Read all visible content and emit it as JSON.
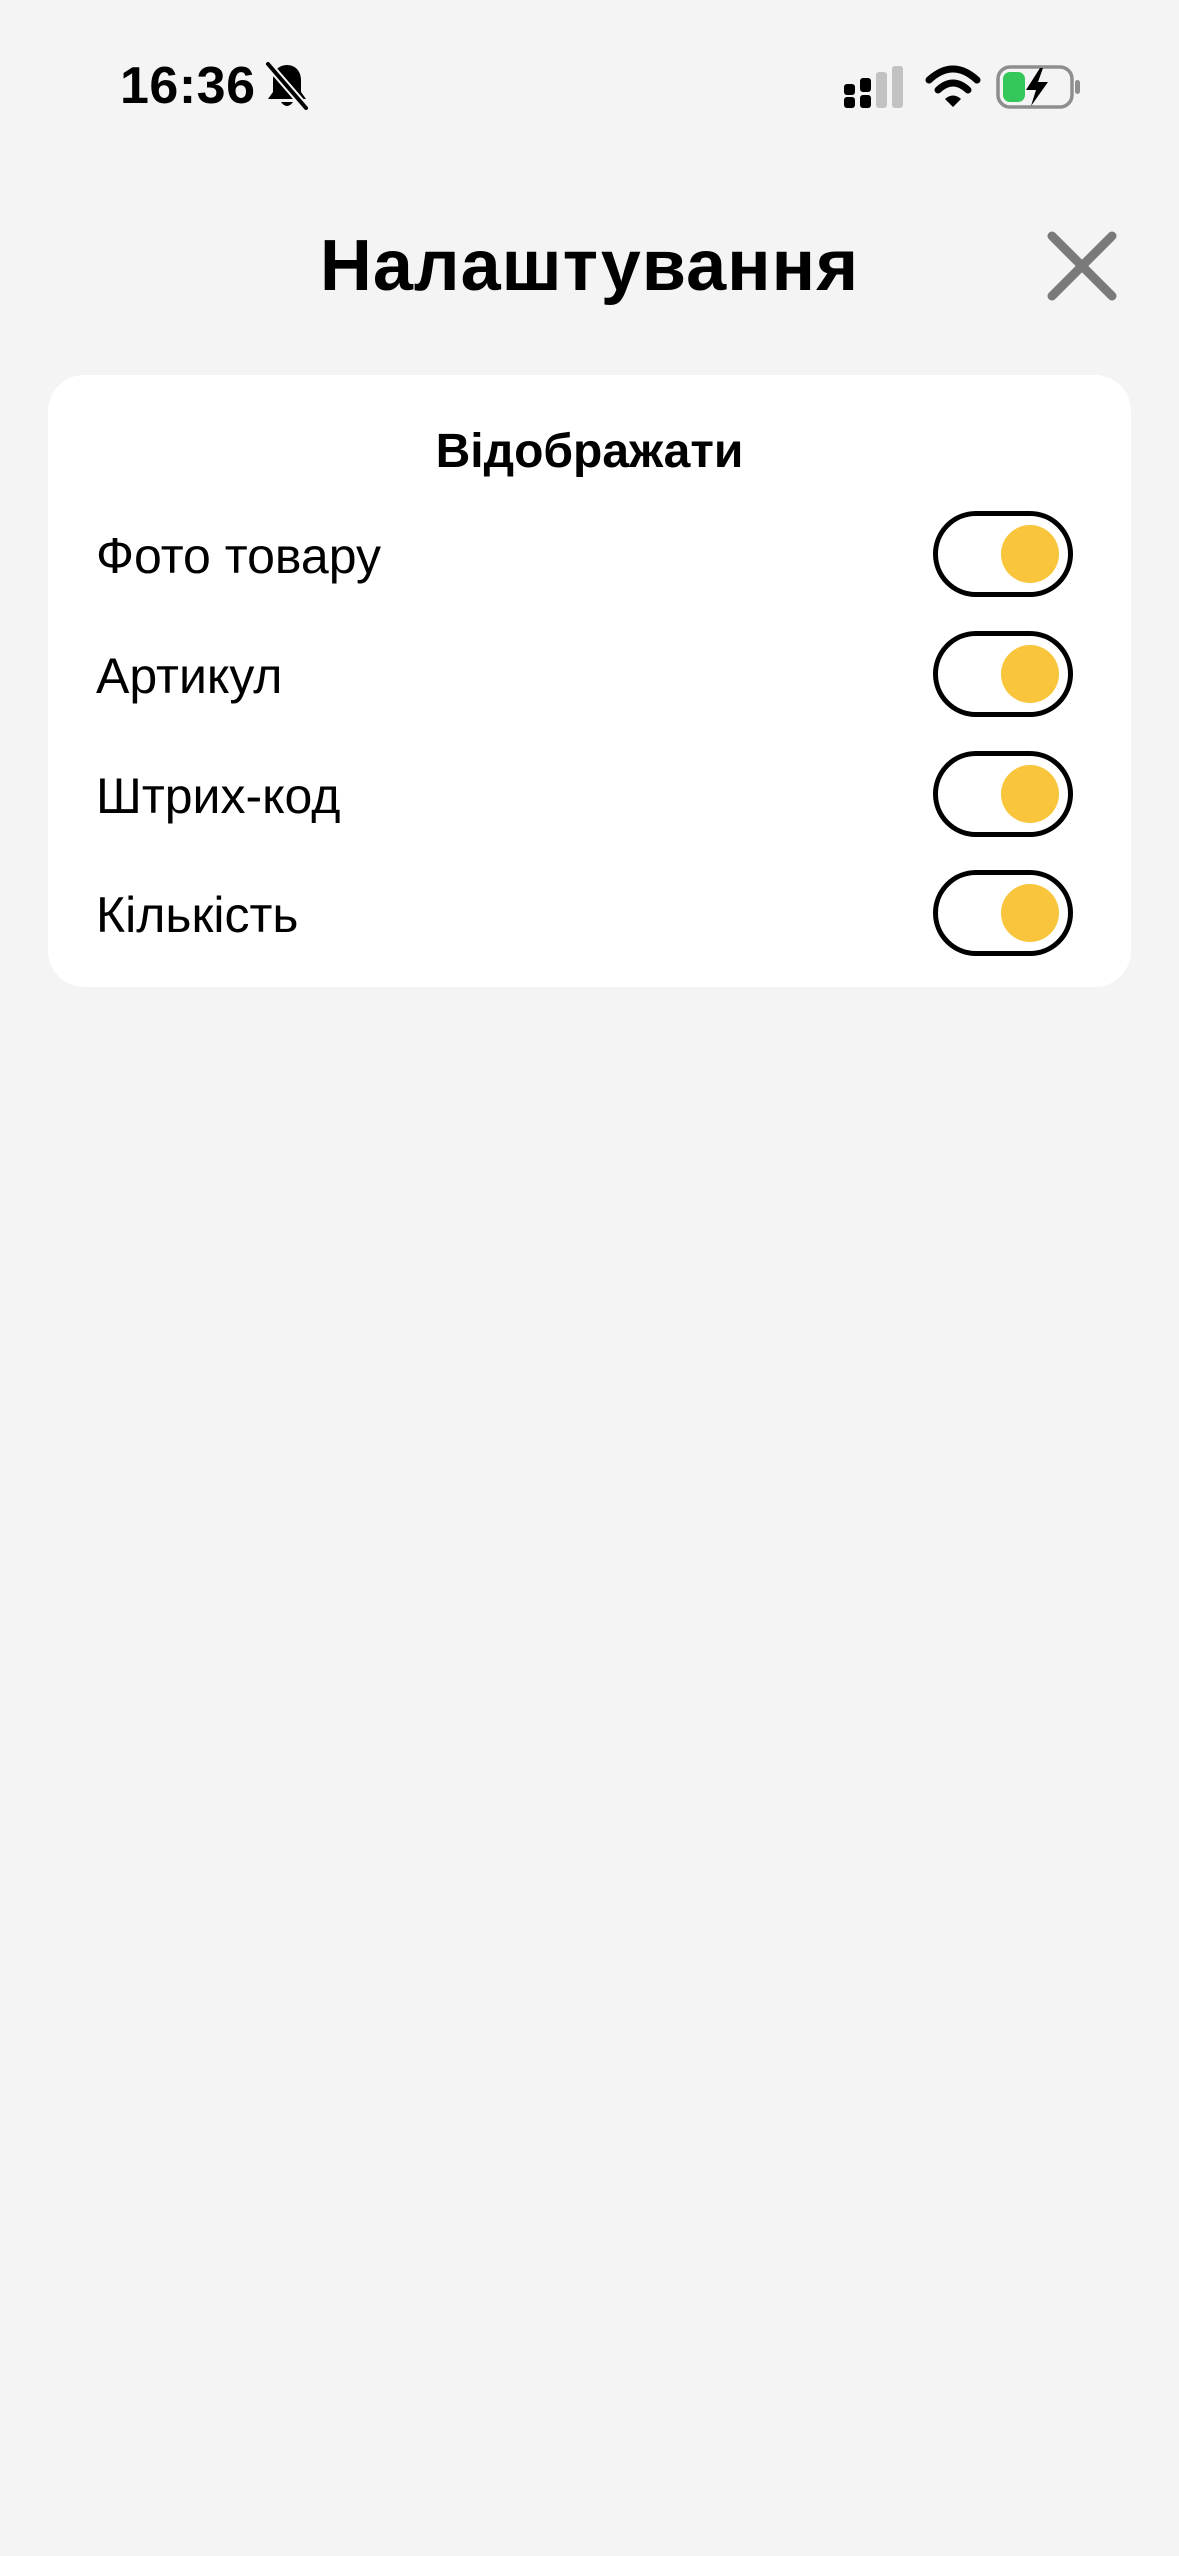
{
  "status_bar": {
    "time": "16:36",
    "icons": [
      "bell-slash-icon",
      "cellular-signal-icon",
      "wifi-icon",
      "battery-charging-icon"
    ]
  },
  "header": {
    "title": "Налаштування",
    "close_icon": "close-icon"
  },
  "display_section": {
    "heading": "Відображати",
    "items": [
      {
        "label": "Фото товару",
        "enabled": true
      },
      {
        "label": "Артикул",
        "enabled": true
      },
      {
        "label": "Штрих-код",
        "enabled": true
      },
      {
        "label": "Кількість",
        "enabled": true
      }
    ]
  },
  "colors": {
    "background": "#f4f4f4",
    "card": "#ffffff",
    "toggle_knob": "#f9c53c",
    "toggle_border": "#000000",
    "close_icon": "#7a7a7a",
    "battery_fill": "#34c759"
  }
}
